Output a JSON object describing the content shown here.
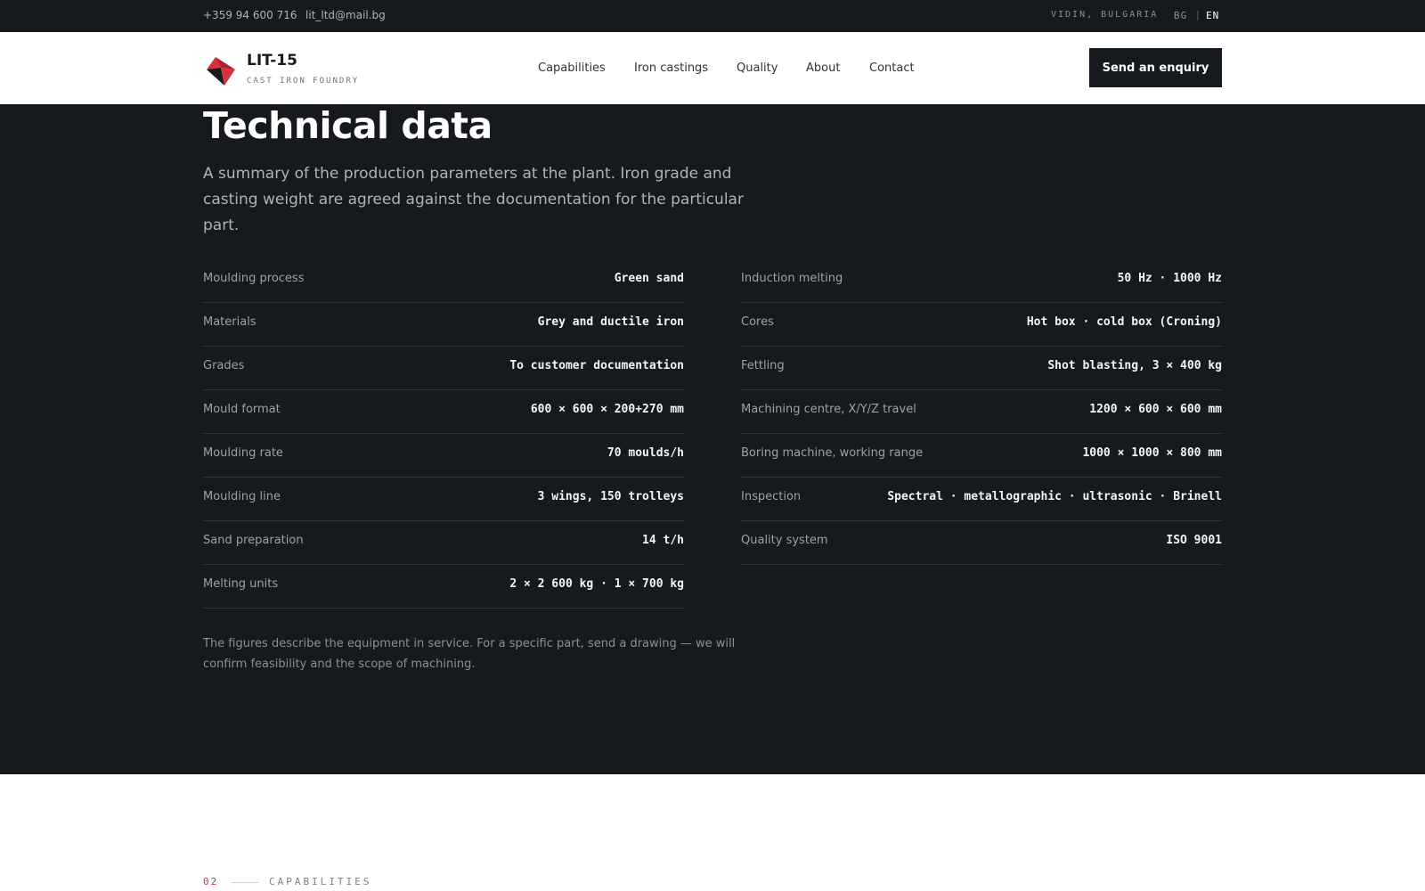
{
  "topbar": {
    "phone": "+359 94 600 716",
    "email": "lit_ltd@mail.bg",
    "location": "VIDIN, BULGARIA",
    "lang_bg": "BG",
    "lang_sep": "|",
    "lang_en": "EN"
  },
  "header": {
    "brand": "LIT-15",
    "tagline": "CAST IRON FOUNDRY",
    "nav": [
      "Capabilities",
      "Iron castings",
      "Quality",
      "About",
      "Contact"
    ],
    "cta": "Send an enquiry"
  },
  "section": {
    "title": "Technical data",
    "intro": "A summary of the production parameters at the plant. Iron grade and casting weight are agreed against the documentation for the particular part.",
    "left": [
      {
        "label": "Moulding process",
        "value": "Green sand"
      },
      {
        "label": "Materials",
        "value": "Grey and ductile iron"
      },
      {
        "label": "Grades",
        "value": "To customer documentation"
      },
      {
        "label": "Mould format",
        "value": "600 × 600 × 200+270 mm"
      },
      {
        "label": "Moulding rate",
        "value": "70 moulds/h"
      },
      {
        "label": "Moulding line",
        "value": "3 wings, 150 trolleys"
      },
      {
        "label": "Sand preparation",
        "value": "14 t/h"
      },
      {
        "label": "Melting units",
        "value": "2 × 2 600 kg · 1 × 700 kg"
      }
    ],
    "right": [
      {
        "label": "Induction melting",
        "value": "50 Hz · 1000 Hz"
      },
      {
        "label": "Cores",
        "value": "Hot box · cold box (Croning)"
      },
      {
        "label": "Fettling",
        "value": "Shot blasting, 3 × 400 kg"
      },
      {
        "label": "Machining centre, X/Y/Z travel",
        "value": "1200 × 600 × 600 mm"
      },
      {
        "label": "Boring machine, working range",
        "value": "1000 × 1000 × 800 mm"
      },
      {
        "label": "Inspection",
        "value": "Spectral · metallographic · ultrasonic · Brinell"
      },
      {
        "label": "Quality system",
        "value": "ISO 9001"
      }
    ],
    "note": "The figures describe the equipment in service. For a specific part, send a drawing — we will confirm feasibility and the scope of machining."
  },
  "next_section": {
    "number": "02",
    "label": "CAPABILITIES"
  },
  "colors": {
    "dark": "#16191d",
    "accent": "#d2333c"
  }
}
